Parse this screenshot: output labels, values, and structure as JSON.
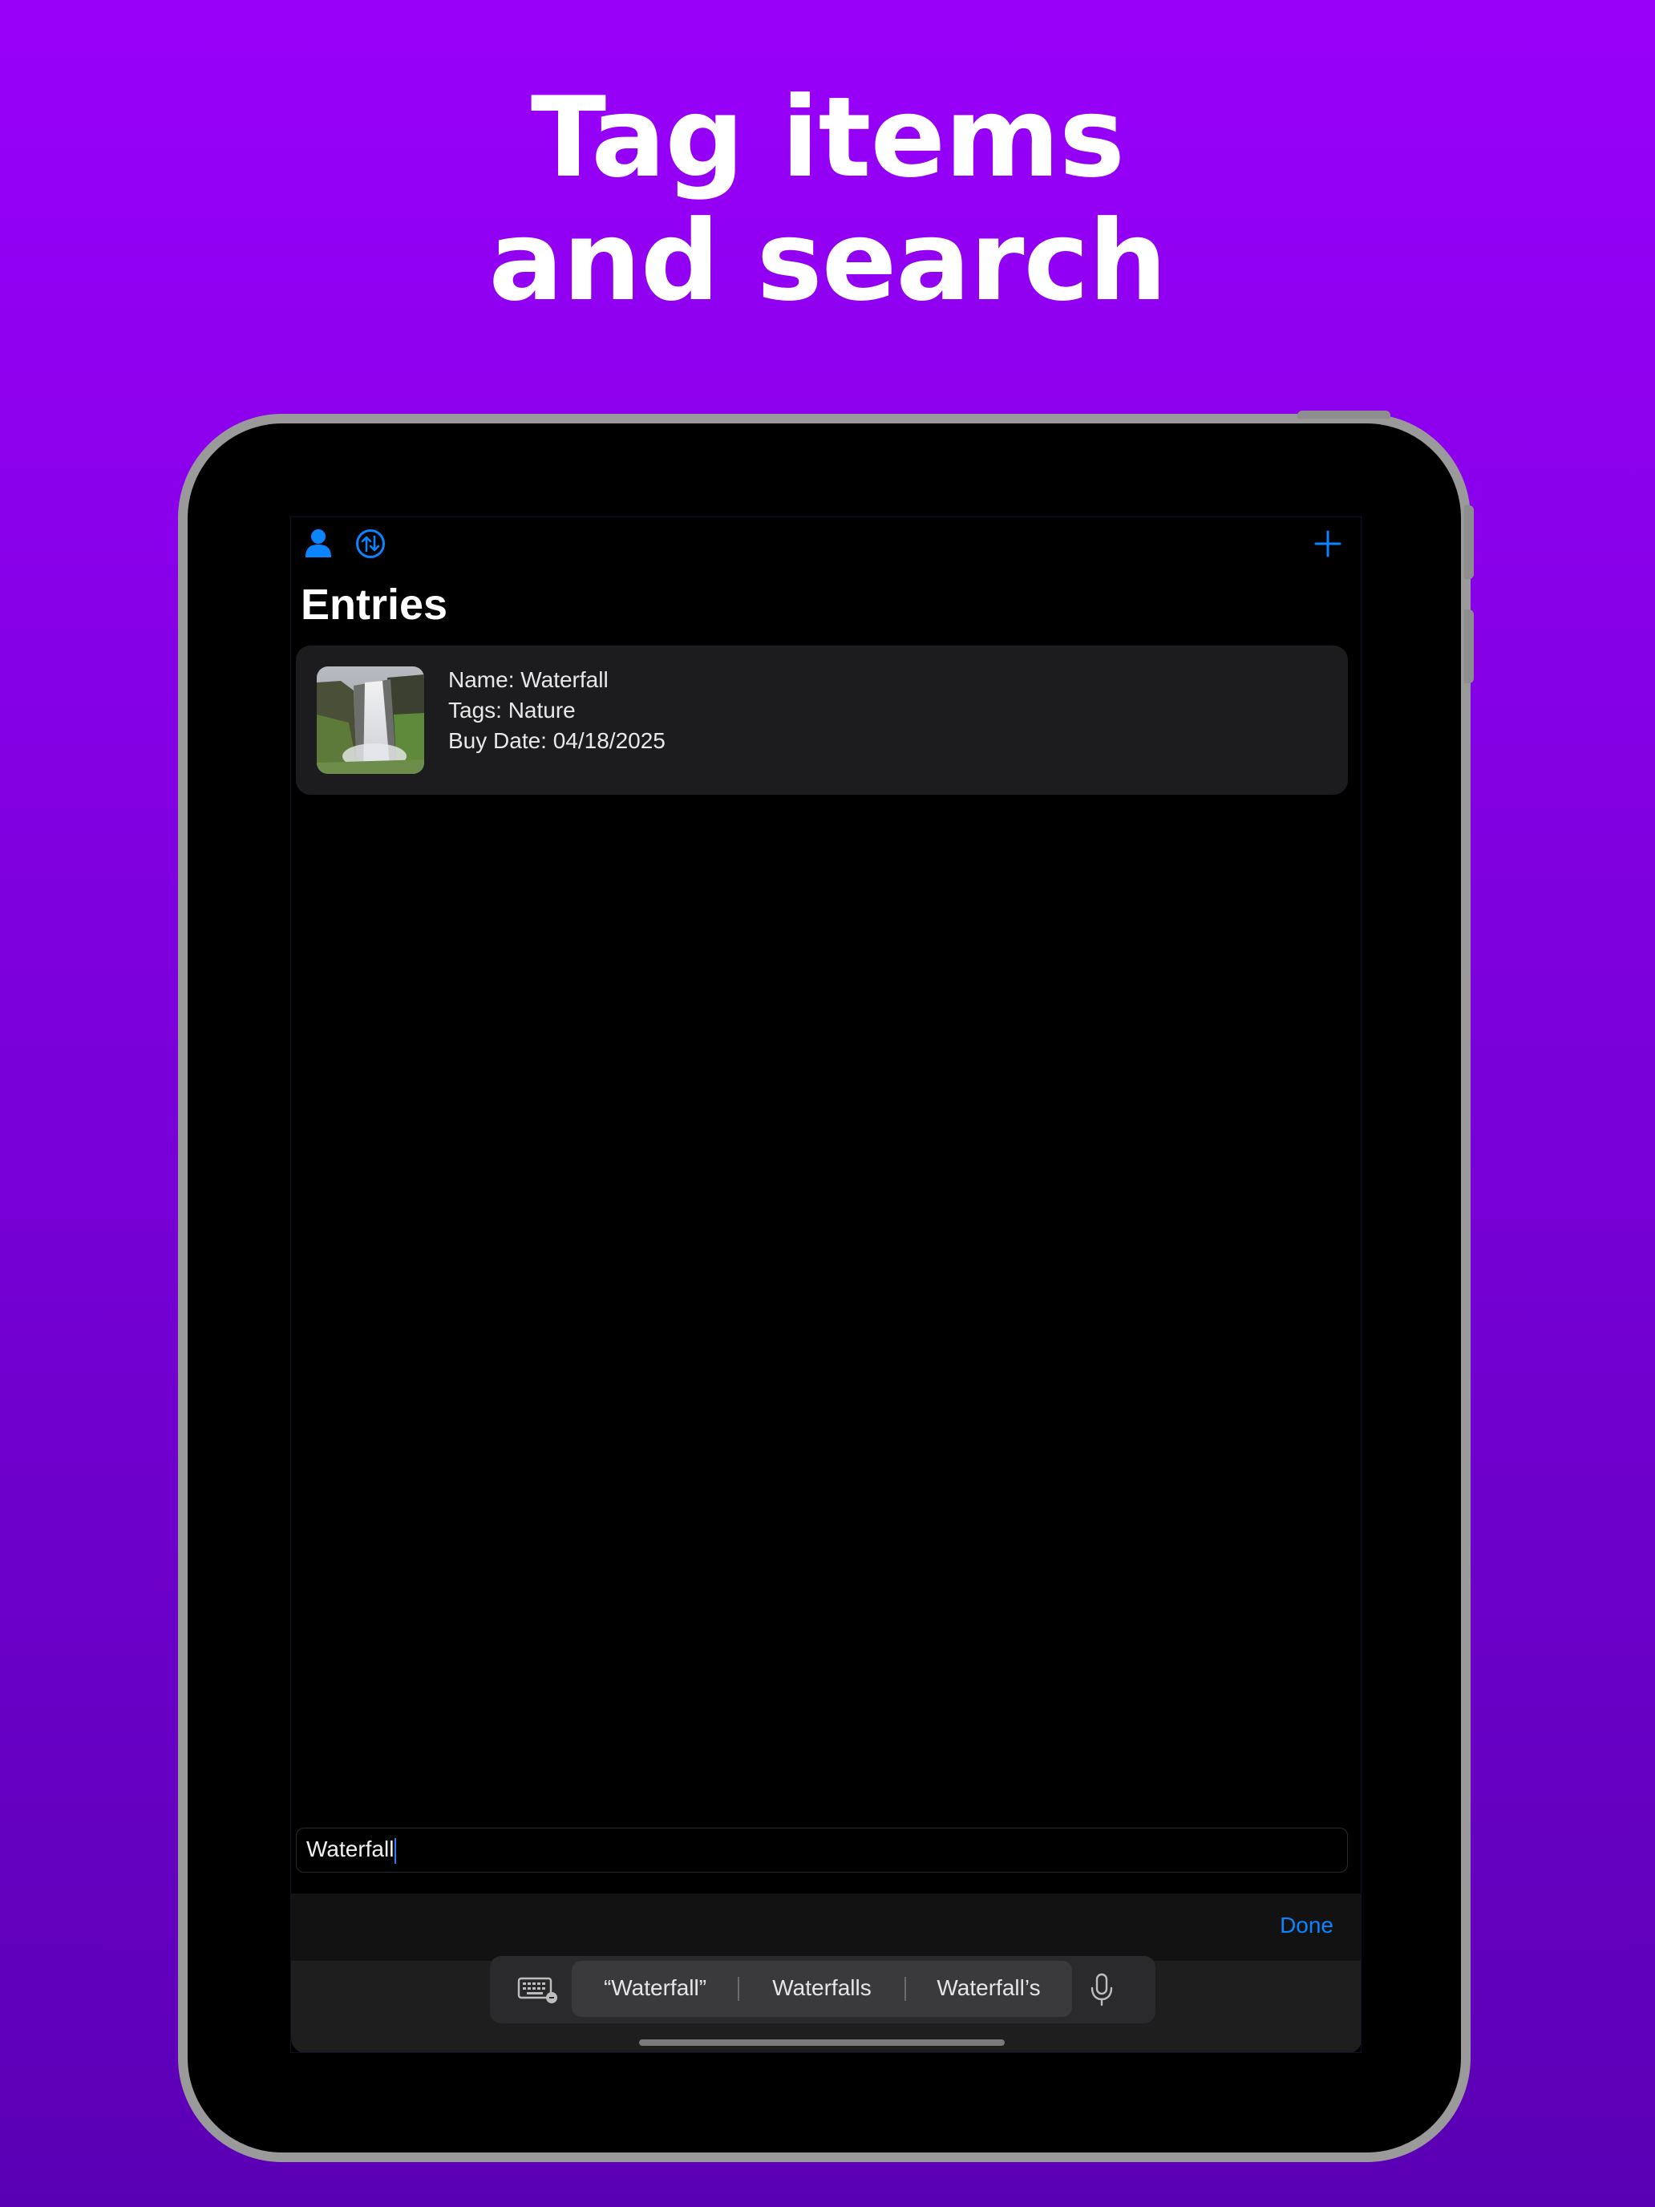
{
  "headline": {
    "line1": "Tag items",
    "line2": "and search"
  },
  "nav": {
    "left_icons": [
      "person-icon",
      "sort-arrows-icon"
    ],
    "right_icon": "plus-icon",
    "accent_color": "#0a84ff"
  },
  "page": {
    "title": "Entries"
  },
  "entries": [
    {
      "name": "Name: Waterfall",
      "tags": "Tags: Nature",
      "buy_date": "Buy Date: 04/18/2025",
      "thumbnail": "waterfall-photo"
    }
  ],
  "search": {
    "value": "Waterfall"
  },
  "keyboard_accessory": {
    "done_label": "Done"
  },
  "keyboard": {
    "suggestions": [
      "“Waterfall”",
      "Waterfalls",
      "Waterfall’s"
    ],
    "left_icon": "keyboard-icon",
    "right_icon": "microphone-icon"
  },
  "colors": {
    "background_top": "#9900fa",
    "background_bottom": "#5a00b4",
    "card": "#1c1c1e"
  }
}
